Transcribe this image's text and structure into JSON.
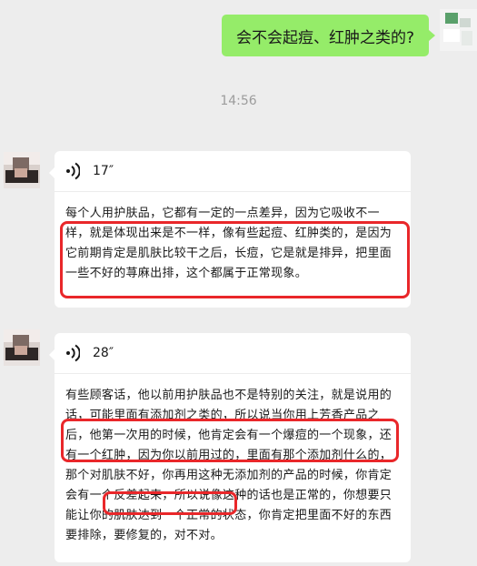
{
  "chat": {
    "outgoing_message": "会不会起痘、红肿之类的?",
    "timestamp": "14:56",
    "messages": [
      {
        "duration": "17″",
        "transcript": "每个人用护肤品，它都有一定的一点差异，因为它吸收不一样，就是体现出来是不一样，像有些起痘、红肿类的，是因为它前期肯定是肌肤比较干之后，长痘，它是就是排异，把里面一些不好的荨麻出排，这个都属于正常现象。"
      },
      {
        "duration": "28″",
        "transcript": "有些顾客话，他以前用护肤品也不是特别的关注，就是说用的话，可能里面有添加剂之类的，所以说当你用上芳香产品之后，他第一次用的时候，他肯定会有一个爆痘的一个现象，还有一个红肿，因为你以前用过的，里面有那个添加剂什么的，那个对肌肤不好，你再用这种无添加剂的产品的时候，你肯定会有一个反差起来，所以说像这种的话也是正常的，你想要只能让你的肌肤达到一个正常的状态，你肯定把里面不好的东西要排除，要修复的，对不对。"
      }
    ]
  },
  "colors": {
    "background": "#ededed",
    "outgoing_bubble": "#95ec69",
    "incoming_card": "#ffffff",
    "highlight": "#e9272a",
    "timestamp_text": "#9c9c9c"
  },
  "icons": {
    "voice": "voice-wave-icon",
    "avatar_self": "avatar-self-pixelated",
    "avatar_other": "avatar-other-pixelated"
  }
}
